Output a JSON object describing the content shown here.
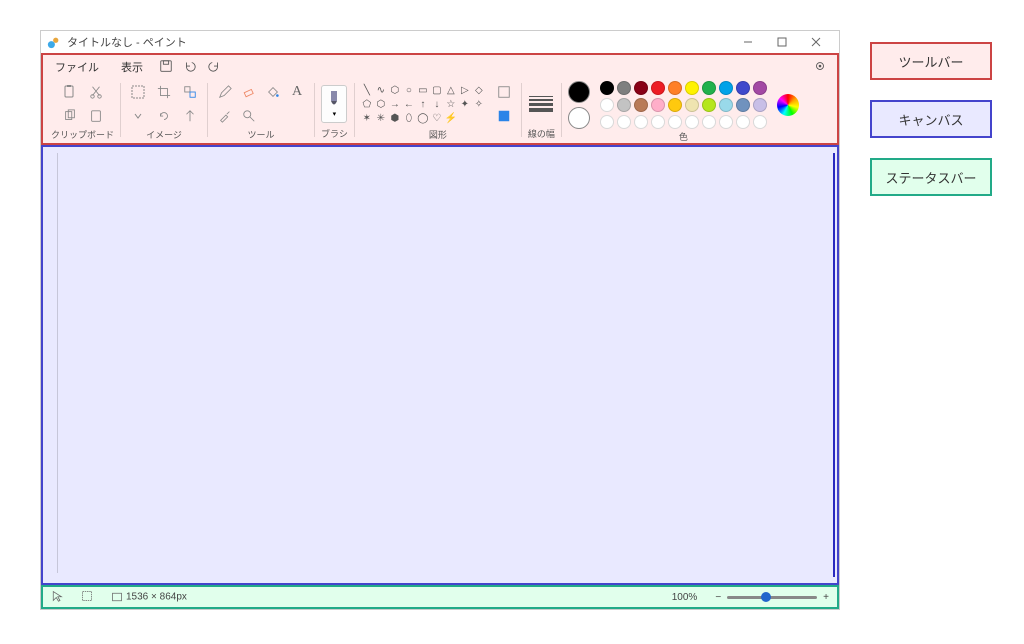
{
  "title": "タイトルなし - ペイント",
  "menubar": {
    "file": "ファイル",
    "view": "表示"
  },
  "ribbon": {
    "clipboard_label": "クリップボード",
    "image_label": "イメージ",
    "tool_label": "ツール",
    "brush_label": "ブラシ",
    "shapes_label": "図形",
    "stroke_label": "線の幅",
    "color_label": "色"
  },
  "colors": {
    "primary": "#000000",
    "secondary": "#ffffff",
    "row1": [
      "#000000",
      "#7f7f7f",
      "#880015",
      "#ed1c24",
      "#ff7f27",
      "#fff200",
      "#22b14c",
      "#00a2e8",
      "#3f48cc",
      "#a349a4"
    ],
    "row2": [
      "#ffffff",
      "#c3c3c3",
      "#b97a57",
      "#ffaec9",
      "#ffc90e",
      "#efe4b0",
      "#b5e61d",
      "#99d9ea",
      "#7092be",
      "#c8bfe7"
    ]
  },
  "status": {
    "dimensions": "1536 × 864px",
    "zoom": "100%"
  },
  "legend": {
    "toolbar": "ツールバー",
    "canvas": "キャンバス",
    "statusbar": "ステータスバー"
  }
}
